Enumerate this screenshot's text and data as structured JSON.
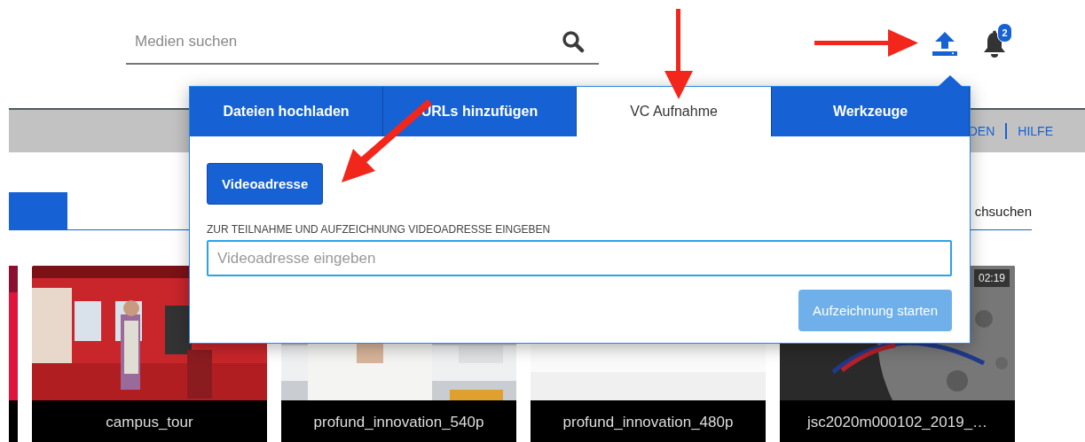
{
  "header": {
    "search": {
      "placeholder": "Medien suchen"
    },
    "notifications": {
      "count": "2"
    }
  },
  "nav_bar": {
    "links": [
      "DEN",
      "HILFE"
    ]
  },
  "page_tabs": {
    "visible_label": "chsuchen"
  },
  "media": [
    {
      "kind": "picture",
      "title": "campus_tour"
    },
    {
      "kind": "picture",
      "title": "profund_innovation_540p"
    },
    {
      "kind": "picture",
      "title": "profund_innovation_480p"
    },
    {
      "kind": "picture",
      "title": "jsc2020m000102_2019_…",
      "duration": "02:19"
    }
  ],
  "upload_popup": {
    "tabs": [
      {
        "label": "Dateien hochladen",
        "selected": false
      },
      {
        "label": "URLs hinzufügen",
        "selected": false
      },
      {
        "label": "VC Aufnahme",
        "selected": true
      },
      {
        "label": "Werkzeuge",
        "selected": false
      }
    ],
    "source_button": "Videoadresse",
    "field_label": "ZUR TEILNAHME UND AUFZEICHNUNG VIDEOADRESSE EINGEBEN",
    "field": {
      "placeholder": "Videoadresse eingeben"
    },
    "submit": {
      "label": "Aufzeichnung starten",
      "disabled": true
    }
  }
}
